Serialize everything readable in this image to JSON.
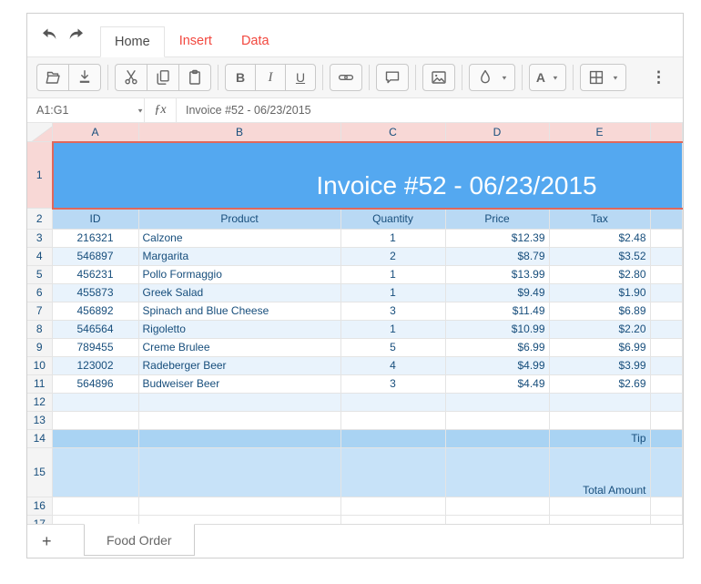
{
  "colors": {
    "accent_red": "#f2483f",
    "selection_border": "#e0685c",
    "title_cell_bg": "#54a8f0",
    "table_header_bg": "#b9d9f4",
    "band_bg": "#e9f3fc",
    "tip_row_bg": "#a9d3f3",
    "total_row_bg": "#c7e2f8",
    "cell_text": "#174e7c",
    "selected_header_pink": "#f8d8d6"
  },
  "tabstrip": {
    "tabs": [
      {
        "label": "Home",
        "active": true
      },
      {
        "label": "Insert",
        "active": false
      },
      {
        "label": "Data",
        "active": false
      }
    ]
  },
  "toolbar": {
    "groups": [
      [
        {
          "name": "open",
          "icon": "folder-open-icon"
        },
        {
          "name": "export",
          "icon": "download-icon"
        }
      ],
      [
        {
          "name": "cut",
          "icon": "scissors-icon"
        },
        {
          "name": "copy",
          "icon": "copy-icon"
        },
        {
          "name": "paste",
          "icon": "clipboard-icon"
        }
      ],
      [
        {
          "name": "bold",
          "label": "B"
        },
        {
          "name": "italic",
          "label": "I"
        },
        {
          "name": "underline",
          "label": "U"
        }
      ],
      [
        {
          "name": "link",
          "icon": "chain-link-icon"
        }
      ],
      [
        {
          "name": "comment",
          "icon": "speech-bubble-icon"
        }
      ],
      [
        {
          "name": "image",
          "icon": "picture-icon"
        }
      ],
      [
        {
          "name": "fill-color",
          "icon": "droplet-icon",
          "dropdown": true
        }
      ],
      [
        {
          "name": "font-color",
          "label": "A",
          "dropdown": true
        }
      ],
      [
        {
          "name": "borders",
          "icon": "borders-grid-icon",
          "dropdown": true
        }
      ]
    ],
    "overflow_glyph": "⋮"
  },
  "formula_bar": {
    "name_box": "A1:G1",
    "fx_label": "ƒx",
    "formula": "Invoice #52 - 06/23/2015"
  },
  "grid": {
    "column_headers": [
      "A",
      "B",
      "C",
      "D",
      "E",
      ""
    ],
    "row_numbers": [
      "1",
      "2",
      "3",
      "4",
      "5",
      "6",
      "7",
      "8",
      "9",
      "10",
      "11",
      "12",
      "13",
      "14",
      "15",
      "16",
      "17"
    ],
    "title": "Invoice #52 - 06/23/2015",
    "table": {
      "headers": [
        "ID",
        "Product",
        "Quantity",
        "Price",
        "Tax"
      ],
      "rows": [
        [
          "216321",
          "Calzone",
          "1",
          "$12.39",
          "$2.48"
        ],
        [
          "546897",
          "Margarita",
          "2",
          "$8.79",
          "$3.52"
        ],
        [
          "456231",
          "Pollo Formaggio",
          "1",
          "$13.99",
          "$2.80"
        ],
        [
          "455873",
          "Greek Salad",
          "1",
          "$9.49",
          "$1.90"
        ],
        [
          "456892",
          "Spinach and Blue Cheese",
          "3",
          "$11.49",
          "$6.89"
        ],
        [
          "546564",
          "Rigoletto",
          "1",
          "$10.99",
          "$2.20"
        ],
        [
          "789455",
          "Creme Brulee",
          "5",
          "$6.99",
          "$6.99"
        ],
        [
          "123002",
          "Radeberger Beer",
          "4",
          "$4.99",
          "$3.99"
        ],
        [
          "564896",
          "Budweiser Beer",
          "3",
          "$4.49",
          "$2.69"
        ]
      ]
    },
    "tip_label": "Tip",
    "total_label": "Total Amount"
  },
  "sheet_bar": {
    "add_label": "+",
    "tabs": [
      {
        "label": "Food Order",
        "active": true
      }
    ]
  }
}
